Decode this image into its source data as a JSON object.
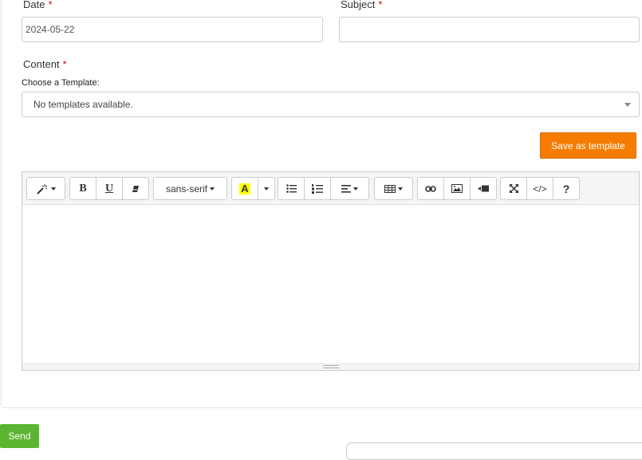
{
  "form": {
    "date_label": "Date",
    "date_value": "2024-05-22",
    "subject_label": "Subject",
    "subject_value": "",
    "content_label": "Content",
    "required_mark": "*",
    "template_label": "Choose a Template:",
    "template_selected": "No templates available.",
    "save_template_label": "Save as template",
    "send_label": "Send"
  },
  "editor": {
    "font_name": "sans-serif",
    "color_glyph": "A",
    "code_glyph": "</>",
    "help_glyph": "?",
    "bold_glyph": "B",
    "underline_glyph": "U"
  },
  "colors": {
    "accent_orange": "#f57c00",
    "send_green": "#5cb531",
    "required_red": "#dd0000",
    "highlight_yellow": "#ffff00"
  }
}
